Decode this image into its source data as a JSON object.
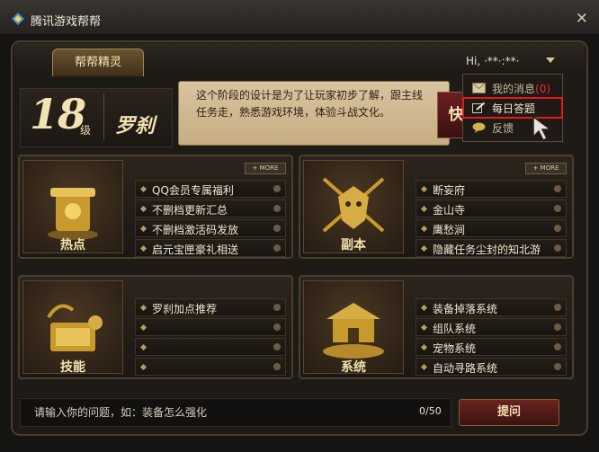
{
  "window": {
    "title": "腾讯游戏帮帮",
    "close_symbol": "×"
  },
  "tab": {
    "label": "帮帮精灵"
  },
  "user": {
    "greeting": "Hi, ·**·:**·"
  },
  "level": {
    "number": "18",
    "unit": "级",
    "class_name": "罗刹"
  },
  "tip": {
    "text": "这个阶段的设计是为了让玩家初步了解，跟主线任务走，熟悉游戏环境，体验斗战文化。"
  },
  "quick_button": {
    "label": "快"
  },
  "menu": {
    "items": [
      {
        "label": "我的消息",
        "count": "(0)",
        "icon": "envelope-icon"
      },
      {
        "label": "每日答题",
        "icon": "edit-icon"
      },
      {
        "label": "反馈",
        "icon": "speech-bubble-icon"
      }
    ]
  },
  "more_label": "+ MORE",
  "cards": [
    {
      "title": "热点",
      "icon": "treasure-icon",
      "items": [
        "QQ会员专属福利",
        "不删档更新汇总",
        "不删档激活码发放",
        "启元宝匣豪礼相送"
      ]
    },
    {
      "title": "副本",
      "icon": "demon-mask-icon",
      "items": [
        "断妄府",
        "金山寺",
        "鹰愁涧",
        "隐藏任务尘封的知北游"
      ]
    },
    {
      "title": "技能",
      "icon": "scroll-book-icon",
      "items": [
        "罗刹加点推荐",
        "",
        "",
        ""
      ]
    },
    {
      "title": "系统",
      "icon": "palace-icon",
      "items": [
        "装备掉落系统",
        "组队系统",
        "宠物系统",
        "自动寻路系统"
      ]
    }
  ],
  "question_input": {
    "placeholder": "请输入你的问题，如：装备怎么强化",
    "char_count": "0/50"
  },
  "ask_button": {
    "label": "提问"
  },
  "colors": {
    "accent_gold": "#f3e2b0",
    "highlight_red": "#e01b1b",
    "background": "#161412"
  }
}
